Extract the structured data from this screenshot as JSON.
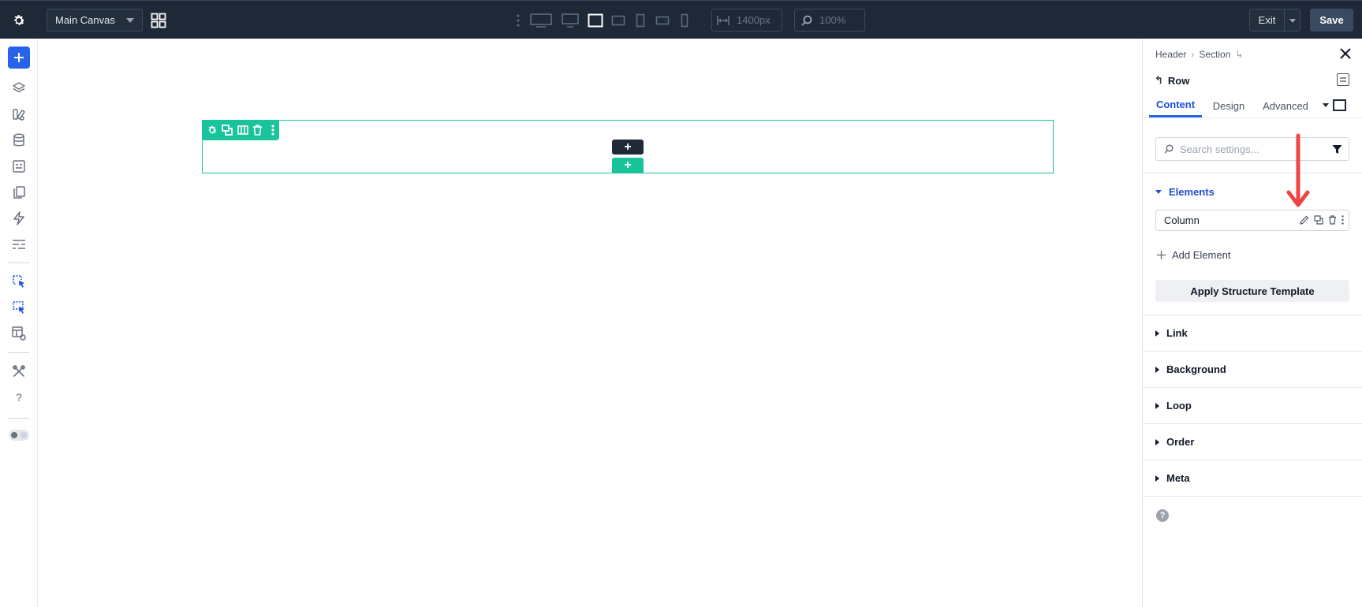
{
  "topbar": {
    "canvas_select": "Main Canvas",
    "width_value": "1400px",
    "zoom_value": "100%",
    "exit_label": "Exit",
    "save_label": "Save"
  },
  "left_rail": {
    "icons": [
      "add-icon",
      "layers-icon",
      "paint-icon",
      "database-icon",
      "form-icon",
      "pages-icon",
      "lightning-icon",
      "settings-list-icon",
      "select-cursor-icon",
      "select-multi-icon",
      "template-gear-icon",
      "tools-icon",
      "help-icon",
      "theme-toggle"
    ]
  },
  "canvas": {
    "row_toolbar_icons": [
      "gear-icon",
      "duplicate-icon",
      "columns-icon",
      "trash-icon",
      "more-icon"
    ]
  },
  "panel": {
    "breadcrumb": [
      "Header",
      "Section"
    ],
    "title": "Row",
    "tabs": [
      "Content",
      "Design",
      "Advanced"
    ],
    "active_tab": "Content",
    "search_placeholder": "Search settings...",
    "elements_heading": "Elements",
    "elements": [
      {
        "label": "Column"
      }
    ],
    "add_element_label": "Add Element",
    "apply_template_label": "Apply Structure Template",
    "sections": [
      "Link",
      "Background",
      "Loop",
      "Order",
      "Meta"
    ]
  },
  "colors": {
    "topbar_bg": "#1e2836",
    "accent_blue": "#2563eb",
    "row_green": "#19c49a",
    "annotation_red": "#ef4444"
  }
}
